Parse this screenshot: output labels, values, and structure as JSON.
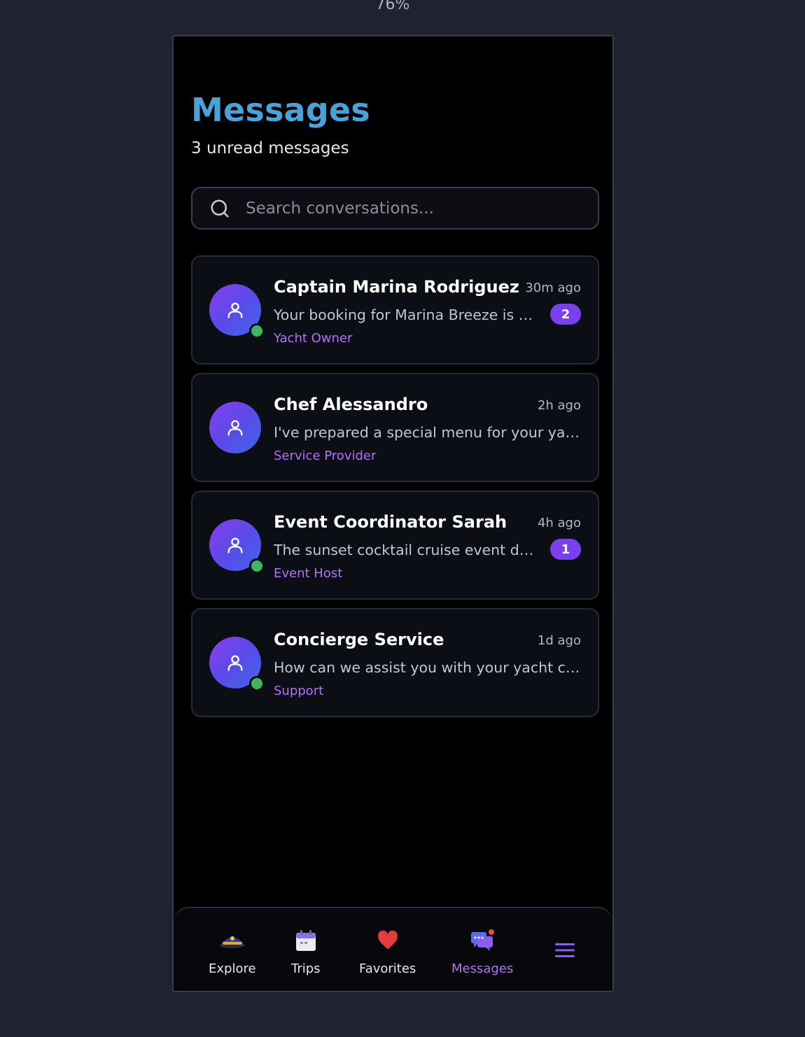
{
  "zoom_level": "76%",
  "header": {
    "title": "Messages",
    "subtitle": "3 unread messages"
  },
  "search": {
    "placeholder": "Search conversations...",
    "value": ""
  },
  "conversations": [
    {
      "name": "Captain Marina Rodriguez",
      "time": "30m ago",
      "preview": "Your booking for Marina Breeze is co...",
      "role": "Yacht Owner",
      "unread": "2",
      "online": true
    },
    {
      "name": "Chef Alessandro",
      "time": "2h ago",
      "preview": "I've prepared a special menu for your yach...",
      "role": "Service Provider",
      "unread": "",
      "online": false
    },
    {
      "name": "Event Coordinator Sarah",
      "time": "4h ago",
      "preview": "The sunset cocktail cruise event deta...",
      "role": "Event Host",
      "unread": "1",
      "online": true
    },
    {
      "name": "Concierge Service",
      "time": "1d ago",
      "preview": "How can we assist you with your yacht clu...",
      "role": "Support",
      "unread": "",
      "online": true
    }
  ],
  "nav": {
    "items": [
      {
        "label": "Explore",
        "icon": "captain-hat-icon"
      },
      {
        "label": "Trips",
        "icon": "calendar-icon"
      },
      {
        "label": "Favorites",
        "icon": "heart-icon"
      },
      {
        "label": "Messages",
        "icon": "chat-bubbles-icon",
        "active": true
      }
    ],
    "menu_icon": "hamburger-menu-icon"
  },
  "colors": {
    "title": "#4aa3d8",
    "accent": "#7b3ff0",
    "role_text": "#b073f5",
    "online": "#3fb55c",
    "background": "#1e2231"
  }
}
